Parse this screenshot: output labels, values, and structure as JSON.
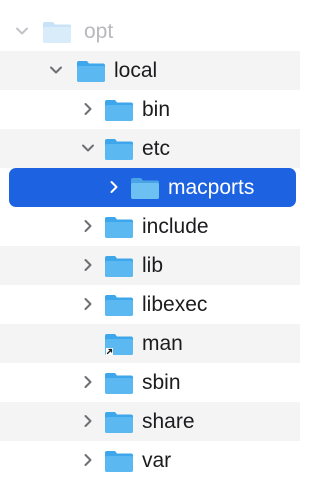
{
  "tree": {
    "items": [
      {
        "label": "opt",
        "depth": 0,
        "expanded": true,
        "state": "dim"
      },
      {
        "label": "local",
        "depth": 1,
        "expanded": true,
        "state": "normal"
      },
      {
        "label": "bin",
        "depth": 2,
        "expanded": false,
        "state": "normal"
      },
      {
        "label": "etc",
        "depth": 2,
        "expanded": true,
        "state": "normal"
      },
      {
        "label": "macports",
        "depth": 3,
        "expanded": false,
        "state": "selected"
      },
      {
        "label": "include",
        "depth": 2,
        "expanded": false,
        "state": "normal"
      },
      {
        "label": "lib",
        "depth": 2,
        "expanded": false,
        "state": "normal"
      },
      {
        "label": "libexec",
        "depth": 2,
        "expanded": false,
        "state": "normal"
      },
      {
        "label": "man",
        "depth": 2,
        "expanded": null,
        "state": "normal",
        "icon": "folder-alias-icon"
      },
      {
        "label": "sbin",
        "depth": 2,
        "expanded": false,
        "state": "normal"
      },
      {
        "label": "share",
        "depth": 2,
        "expanded": false,
        "state": "normal"
      },
      {
        "label": "var",
        "depth": 2,
        "expanded": false,
        "state": "normal"
      }
    ]
  },
  "colors": {
    "selection": "#1d62e0",
    "folder_blue": "#5bb8f0",
    "folder_dim": "#c8e3f7",
    "stripe": "#f4f4f5"
  }
}
